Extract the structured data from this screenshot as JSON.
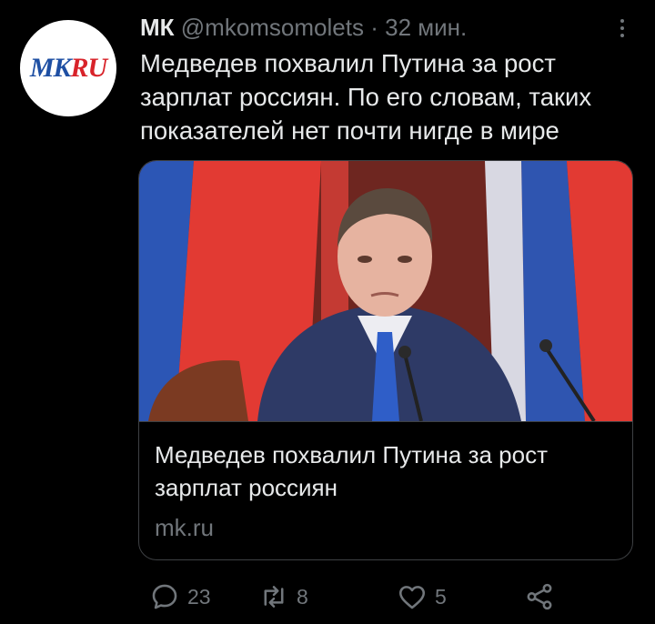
{
  "tweet": {
    "display_name": "МК",
    "handle": "@mkomsomolets",
    "separator": "·",
    "time": "32 мин.",
    "text": "Медведев похвалил Путина за рост зарплат россиян. По его словам, таких показателей нет почти нигде в мире",
    "avatar_logo": {
      "left": "MK",
      "right": "RU"
    }
  },
  "card": {
    "title": "Медведев похвалил Путина за рост зарплат россиян",
    "domain": "mk.ru"
  },
  "actions": {
    "reply_count": "23",
    "retweet_count": "8",
    "like_count": "5"
  },
  "icons": {
    "more": "more-vertical-icon",
    "reply": "reply-icon",
    "retweet": "retweet-icon",
    "like": "heart-icon",
    "share": "share-icon"
  },
  "colors": {
    "background": "#000000",
    "text_primary": "#e7e9ea",
    "text_secondary": "#71767b",
    "border": "#3e4144",
    "logo_blue": "#1e4fa3",
    "logo_red": "#d8232a"
  }
}
